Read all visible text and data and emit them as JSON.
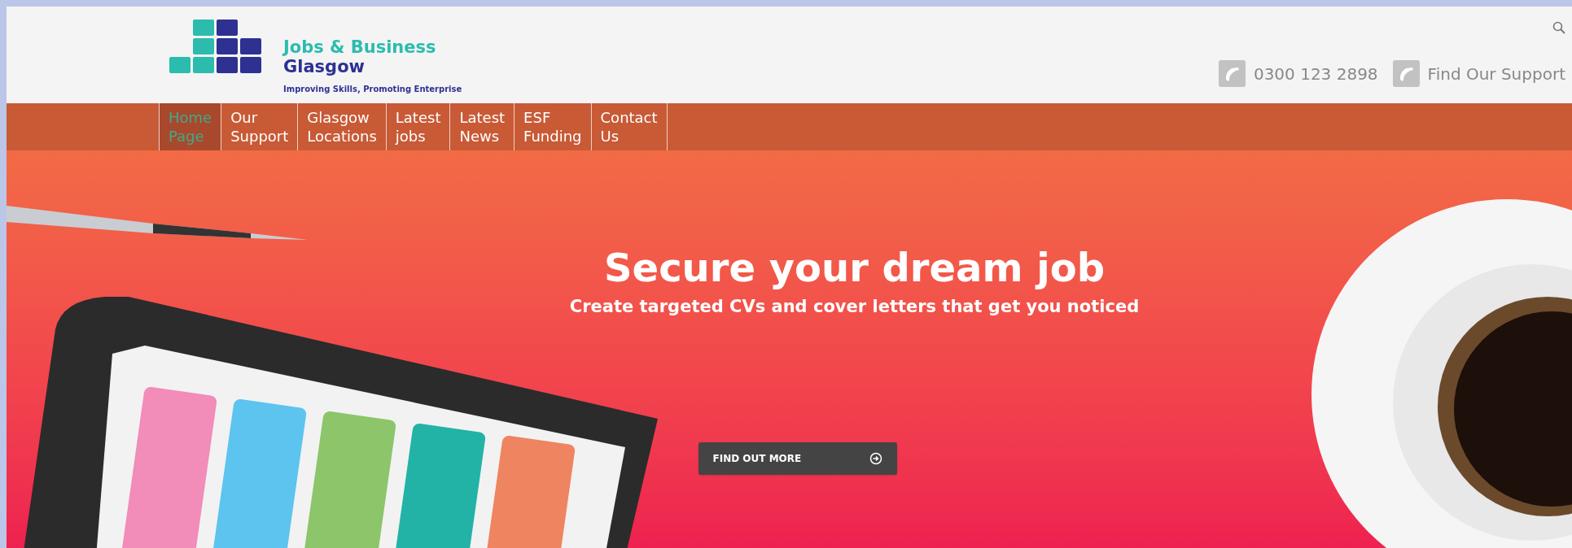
{
  "logo": {
    "title_line_1": "Jobs & Business",
    "title_line_2": "Glasgow",
    "tagline": "Improving Skills, Promoting Enterprise"
  },
  "contacts": [
    {
      "text": "0300 123 2898"
    },
    {
      "text": "Find Our Support"
    }
  ],
  "nav": [
    {
      "label": "Home Page",
      "selected": true
    },
    {
      "label": "Our Support",
      "selected": false
    },
    {
      "label": "Glasgow Locations",
      "selected": false
    },
    {
      "label": "Latest jobs",
      "selected": false
    },
    {
      "label": "Latest News",
      "selected": false
    },
    {
      "label": "ESF Funding",
      "selected": false
    },
    {
      "label": "Contact Us",
      "selected": false
    }
  ],
  "hero": {
    "title": "Secure your dream job",
    "subtitle": "Create targeted CVs and cover letters that get you noticed",
    "button": "FIND OUT MORE"
  }
}
